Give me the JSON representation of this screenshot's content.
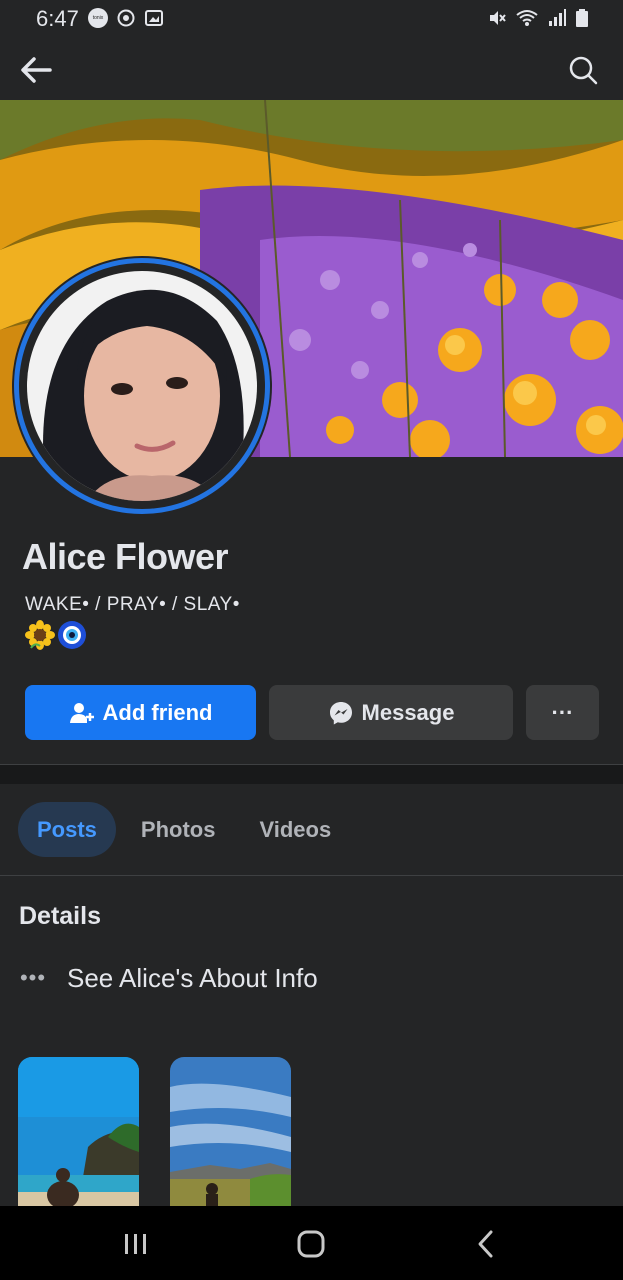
{
  "status_bar": {
    "time": "6:47",
    "notification_app": "tonix",
    "icons": [
      "sync-icon",
      "image-icon",
      "mute-icon",
      "wifi-icon",
      "signal-icon",
      "battery-icon"
    ]
  },
  "top_bar": {
    "back_icon": "arrow-left-icon",
    "search_icon": "search-icon"
  },
  "profile": {
    "name": "Alice Flower",
    "bio_line": "WAKE• / PRAY• / SLAY•",
    "bio_emojis": [
      "sunflower",
      "nazar-amulet"
    ],
    "accent_color": "#1877f2",
    "ring_color": "#2374e1"
  },
  "actions": {
    "add_friend_label": "Add friend",
    "message_label": "Message",
    "more_label": "···"
  },
  "tabs": [
    {
      "label": "Posts",
      "active": true
    },
    {
      "label": "Photos",
      "active": false
    },
    {
      "label": "Videos",
      "active": false
    }
  ],
  "details": {
    "title": "Details",
    "about_link": "See Alice's About Info",
    "about_dots": "•••"
  },
  "nav_bar": {
    "icons": [
      "recent-apps-icon",
      "home-icon",
      "back-icon"
    ]
  }
}
